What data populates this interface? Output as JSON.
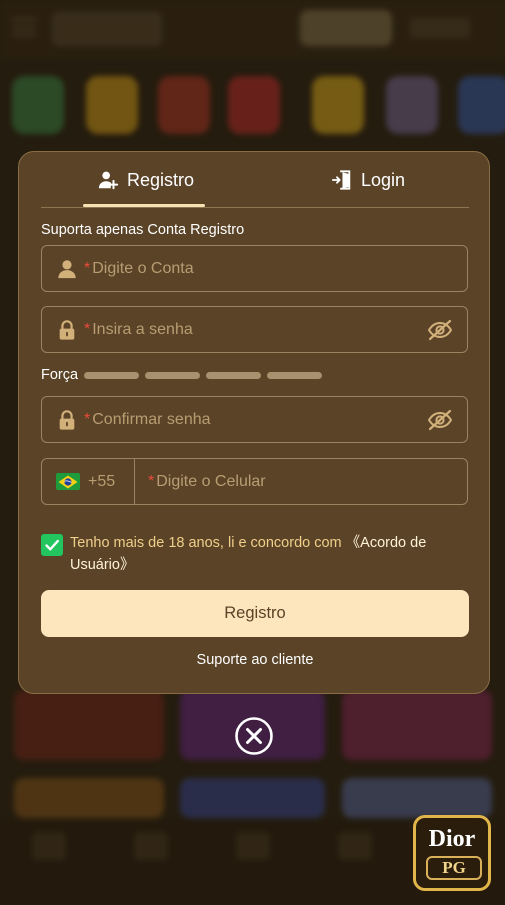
{
  "tabs": {
    "register_label": "Registro",
    "login_label": "Login"
  },
  "form": {
    "hint": "Suporta apenas Conta Registro",
    "account_placeholder": "Digite o Conta",
    "password_placeholder": "Insira a senha",
    "strength_label": "Força",
    "confirm_placeholder": "Confirmar senha",
    "country_code": "+55",
    "phone_placeholder": "Digite o Celular",
    "required_mark": "*",
    "agree_text": "Tenho mais de 18 anos, li e concordo com ",
    "agree_link": "《Acordo de Usuário》",
    "agree_checked": true,
    "submit_label": "Registro",
    "support_label": "Suporte ao cliente"
  },
  "logo": {
    "line1": "Dior",
    "line2": "PG"
  },
  "colors": {
    "modal_bg": "#5a4327",
    "accent": "#fde6bd",
    "required": "#e94b3c",
    "checkbox": "#22c55e",
    "agree_text": "#f0cf8a"
  },
  "icons": {
    "register_tab": "user-plus-icon",
    "login_tab": "door-login-icon",
    "account": "user-icon",
    "password": "lock-icon",
    "toggle": "eye-off-icon",
    "flag": "brazil-flag-icon",
    "close": "close-circle-icon"
  }
}
